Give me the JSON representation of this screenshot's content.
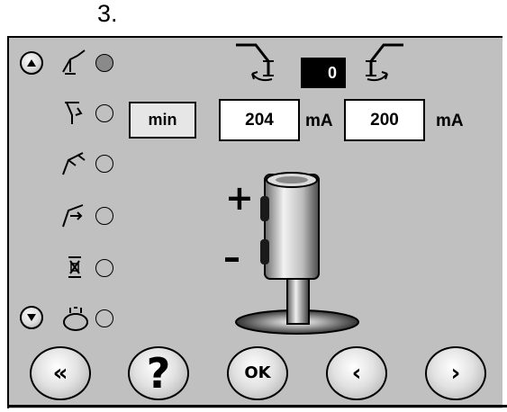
{
  "header": {
    "step_number": "3."
  },
  "nav_up_button": {
    "icon": "triangle-up-icon"
  },
  "nav_down_button": {
    "icon": "triangle-down-icon"
  },
  "modes": [
    {
      "icon": "hitch-lift-icon",
      "active": true
    },
    {
      "icon": "hitch-lower-icon",
      "active": false
    },
    {
      "icon": "hitch-position-icon",
      "active": false
    },
    {
      "icon": "hitch-float-icon",
      "active": false
    },
    {
      "icon": "valve-icon",
      "active": false
    },
    {
      "icon": "hydraulic-coupler-icon",
      "active": false
    }
  ],
  "calibration": {
    "min_label": "min",
    "counter_value": "0",
    "left_value": "204",
    "left_unit": "mA",
    "right_value": "200",
    "right_unit": "mA"
  },
  "joystick": {
    "plus_label": "+",
    "minus_label": "–"
  },
  "footer_buttons": [
    {
      "label": "«",
      "icon": "double-chevron-left-icon"
    },
    {
      "label": "?",
      "icon": "help-icon"
    },
    {
      "label": "OK",
      "icon": "ok-icon"
    },
    {
      "label": "‹",
      "icon": "chevron-left-icon"
    },
    {
      "label": "›",
      "icon": "chevron-right-icon"
    }
  ],
  "colors": {
    "panel": "#c0c0c0",
    "indicator_active": "#8a8a8a",
    "dark_value_bg": "#000000"
  }
}
